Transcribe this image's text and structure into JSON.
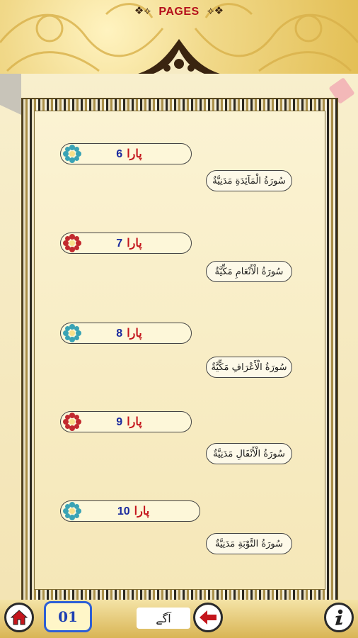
{
  "header": {
    "title": "PAGES"
  },
  "paras": [
    {
      "word": "پارا",
      "number": "6",
      "surah": "سُورَةُ الْمَآئِدَةِ مَدَنِيَّةٌ",
      "flower_color": "#3aa3b5"
    },
    {
      "word": "پارا",
      "number": "7",
      "surah": "سُورَةُ الْأَنْعَامِ مَكِّيَّةٌ",
      "flower_color": "#c22a2f"
    },
    {
      "word": "پارا",
      "number": "8",
      "surah": "سُورَةُ الْأَعْرَافِ مَكِّيَّةٌ",
      "flower_color": "#3aa3b5"
    },
    {
      "word": "پارا",
      "number": "9",
      "surah": "سُورَةُ الْأَنْفَالِ مَدَنِيَّةٌ",
      "flower_color": "#c22a2f"
    },
    {
      "word": "پارا",
      "number": "10",
      "surah": "سُورَةُ التَّوْبَةِ مَدَنِيَّةٌ",
      "flower_color": "#3aa3b5"
    }
  ],
  "bottom_bar": {
    "page_number": "01",
    "next_label": "آگے",
    "home_icon": "home-icon",
    "back_icon": "arrow-left-icon",
    "info_icon": "info-icon"
  },
  "colors": {
    "accent_red": "#c4151c",
    "number_blue": "#1b2a9e",
    "page_box_blue": "#2d5fd6"
  }
}
